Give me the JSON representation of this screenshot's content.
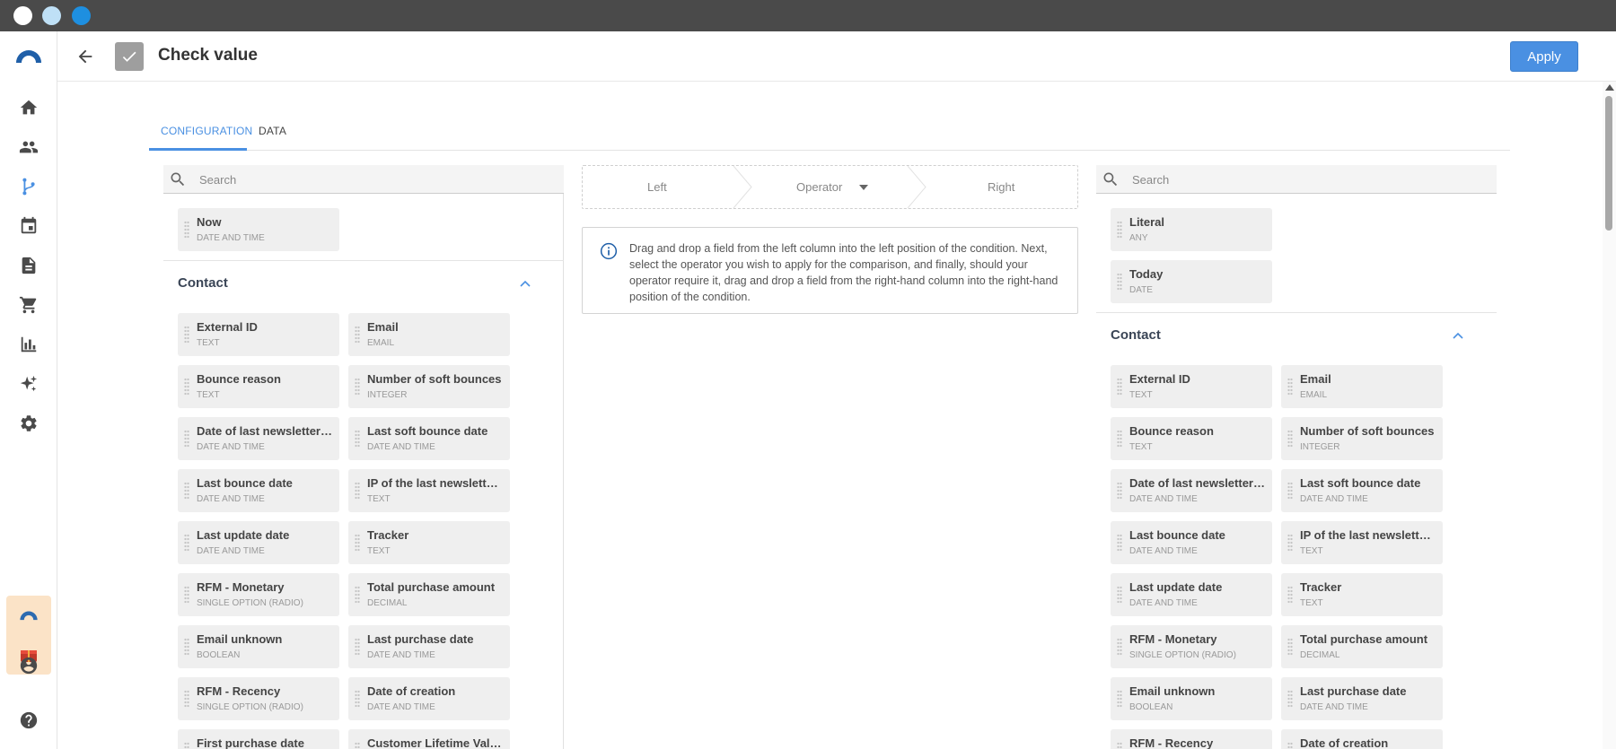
{
  "header": {
    "title": "Check value",
    "apply_label": "Apply"
  },
  "tabs": [
    {
      "label": "CONFIGURATION",
      "active": true
    },
    {
      "label": "DATA",
      "active": false
    }
  ],
  "left": {
    "search_placeholder": "Search",
    "top_fields": [
      {
        "name": "Now",
        "type": "DATE AND TIME"
      }
    ],
    "group_title": "Contact",
    "fields": [
      {
        "name": "External ID",
        "type": "TEXT"
      },
      {
        "name": "Email",
        "type": "EMAIL"
      },
      {
        "name": "Bounce reason",
        "type": "TEXT"
      },
      {
        "name": "Number of soft bounces",
        "type": "INTEGER"
      },
      {
        "name": "Date of last newsletter…",
        "type": "DATE AND TIME"
      },
      {
        "name": "Last soft bounce date",
        "type": "DATE AND TIME"
      },
      {
        "name": "Last bounce date",
        "type": "DATE AND TIME"
      },
      {
        "name": "IP of the last newslette…",
        "type": "TEXT"
      },
      {
        "name": "Last update date",
        "type": "DATE AND TIME"
      },
      {
        "name": "Tracker",
        "type": "TEXT"
      },
      {
        "name": "RFM - Monetary",
        "type": "SINGLE OPTION (RADIO)"
      },
      {
        "name": "Total purchase amount",
        "type": "DECIMAL"
      },
      {
        "name": "Email unknown",
        "type": "BOOLEAN"
      },
      {
        "name": "Last purchase date",
        "type": "DATE AND TIME"
      },
      {
        "name": "RFM - Recency",
        "type": "SINGLE OPTION (RADIO)"
      },
      {
        "name": "Date of creation",
        "type": "DATE AND TIME"
      },
      {
        "name": "First purchase date",
        "type": ""
      },
      {
        "name": "Customer Lifetime Val…",
        "type": ""
      }
    ]
  },
  "condition": {
    "left": "Left",
    "operator": "Operator",
    "right": "Right"
  },
  "info_text": "Drag and drop a field from the left column into the left position of the condition. Next, select the operator you wish to apply for the comparison, and finally, should your operator require it, drag and drop a field from the right-hand column into the right-hand position of the condition.",
  "right": {
    "search_placeholder": "Search",
    "top_fields": [
      {
        "name": "Literal",
        "type": "ANY"
      },
      {
        "name": "Today",
        "type": "DATE"
      }
    ],
    "group_title": "Contact",
    "fields": [
      {
        "name": "External ID",
        "type": "TEXT"
      },
      {
        "name": "Email",
        "type": "EMAIL"
      },
      {
        "name": "Bounce reason",
        "type": "TEXT"
      },
      {
        "name": "Number of soft bounces",
        "type": "INTEGER"
      },
      {
        "name": "Date of last newsletter…",
        "type": "DATE AND TIME"
      },
      {
        "name": "Last soft bounce date",
        "type": "DATE AND TIME"
      },
      {
        "name": "Last bounce date",
        "type": "DATE AND TIME"
      },
      {
        "name": "IP of the last newslette…",
        "type": "TEXT"
      },
      {
        "name": "Last update date",
        "type": "DATE AND TIME"
      },
      {
        "name": "Tracker",
        "type": "TEXT"
      },
      {
        "name": "RFM - Monetary",
        "type": "SINGLE OPTION (RADIO)"
      },
      {
        "name": "Total purchase amount",
        "type": "DECIMAL"
      },
      {
        "name": "Email unknown",
        "type": "BOOLEAN"
      },
      {
        "name": "Last purchase date",
        "type": "DATE AND TIME"
      },
      {
        "name": "RFM - Recency",
        "type": ""
      },
      {
        "name": "Date of creation",
        "type": ""
      }
    ]
  },
  "rail_icons": [
    "home-icon",
    "people-icon",
    "flow-icon",
    "calendar-icon",
    "document-icon",
    "cart-icon",
    "chart-icon",
    "sparkle-icon",
    "gear-icon",
    "account-icon",
    "help-icon"
  ],
  "colors": {
    "accent": "#4a90e2",
    "chrome": "#4a4a4a"
  }
}
